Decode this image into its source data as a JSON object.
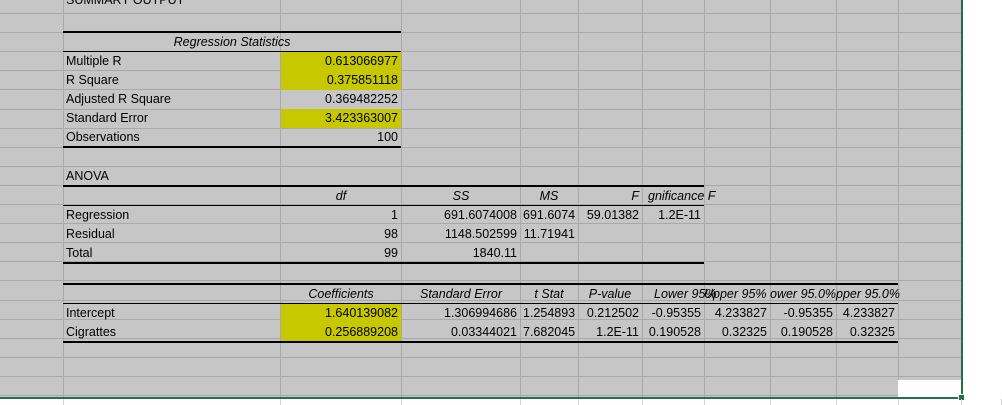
{
  "summary_title": "SUMMARY OUTPUT",
  "regression_statistics": {
    "title": "Regression Statistics",
    "rows": [
      {
        "label": "Multiple R",
        "value": "0.613066977",
        "highlight": true
      },
      {
        "label": "R Square",
        "value": "0.375851118",
        "highlight": true
      },
      {
        "label": "Adjusted R Square",
        "value": "0.369482252",
        "highlight": false
      },
      {
        "label": "Standard Error",
        "value": "3.423363007",
        "highlight": true
      },
      {
        "label": "Observations",
        "value": "100",
        "highlight": false
      }
    ]
  },
  "anova": {
    "title": "ANOVA",
    "headers": {
      "df": "df",
      "ss": "SS",
      "ms": "MS",
      "f": "F",
      "sigf": "gnificance F"
    },
    "rows": [
      {
        "label": "Regression",
        "df": "1",
        "ss": "691.6074008",
        "ms": "691.6074",
        "f": "59.01382",
        "sigf": "1.2E-11"
      },
      {
        "label": "Residual",
        "df": "98",
        "ss": "1148.502599",
        "ms": "11.71941",
        "f": "",
        "sigf": ""
      },
      {
        "label": "Total",
        "df": "99",
        "ss": "1840.11",
        "ms": "",
        "f": "",
        "sigf": ""
      }
    ]
  },
  "coefficients": {
    "headers": {
      "coef": "Coefficients",
      "se": "Standard Error",
      "t": "t Stat",
      "p": "P-value",
      "lower95": "Lower 95%",
      "upper95": "Upper 95%",
      "lower950": "ower 95.0%",
      "upper950": "pper 95.0%"
    },
    "rows": [
      {
        "label": "Intercept",
        "coef": "1.640139082",
        "se": "1.306994686",
        "t": "1.254893",
        "p": "0.212502",
        "lower95": "-0.95355",
        "upper95": "4.233827",
        "lower950": "-0.95355",
        "upper950": "4.233827"
      },
      {
        "label": "Cigrattes",
        "coef": "0.256889208",
        "se": "0.03344021",
        "t": "7.682045",
        "p": "1.2E-11",
        "lower95": "0.190528",
        "upper95": "0.32325",
        "lower950": "0.190528",
        "upper950": "0.32325"
      }
    ]
  },
  "colors": {
    "grid_background": "#c6c6c6",
    "gridline": "#a9a9a9",
    "highlight": "#c8c800",
    "selection_border": "#217346"
  }
}
